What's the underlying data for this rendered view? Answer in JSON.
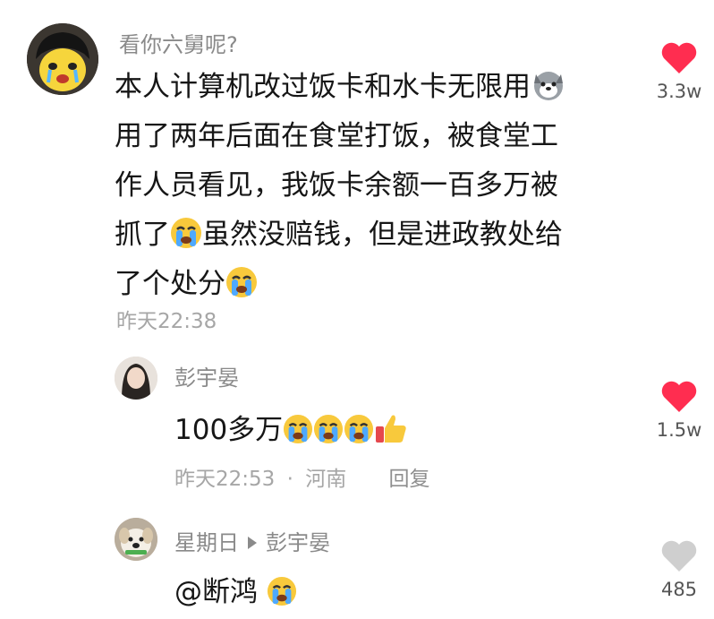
{
  "comment1": {
    "user": "看你六舅呢?",
    "lines": [
      "本人计算机改过饭卡和水卡无限用",
      "用了两年后面在食堂打饭，被食堂工",
      "作人员看见，我饭卡余额一百多万被",
      "抓了",
      "虽然没赔钱，但是进政教处给",
      "了个处分"
    ],
    "time": "昨天22:38",
    "likes": "3.3w",
    "like_color": "#ff2d50"
  },
  "reply1": {
    "user": "彭宇晏",
    "text": "100多万",
    "time": "昨天22:53",
    "separator": "·",
    "location": "河南",
    "reply_label": "回复",
    "likes": "1.5w",
    "like_color": "#ff2d50"
  },
  "reply2": {
    "user": "星期日",
    "target": "彭宇晏",
    "text": "@断鸿",
    "likes": "485",
    "like_color": "#cfcfcf"
  },
  "icons": {
    "avatar1": "cartoon-crying-avatar",
    "avatar2": "girl-avatar",
    "avatar3": "dog-avatar",
    "husky": "husky-emoji",
    "crying": "loudly-crying-emoji",
    "thumb": "thumbs-up-emoji"
  }
}
